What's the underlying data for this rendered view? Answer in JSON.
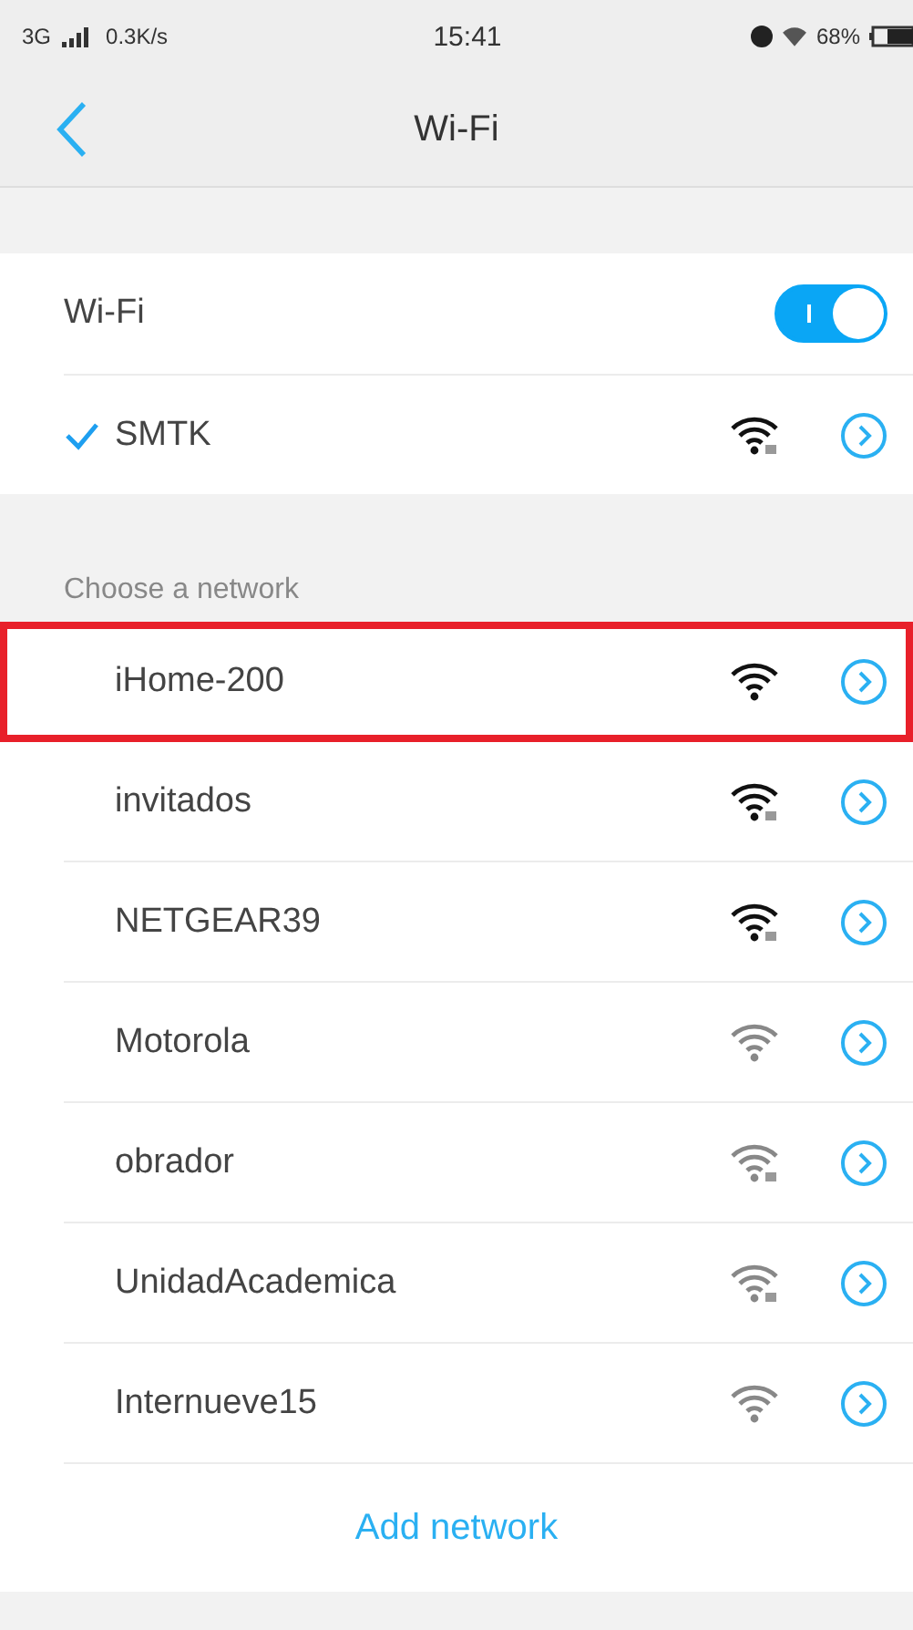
{
  "status_bar": {
    "network": "3G",
    "speed": "0.3K/s",
    "time": "15:41",
    "battery": "68%"
  },
  "nav": {
    "title": "Wi-Fi"
  },
  "wifi_switch": {
    "label": "Wi-Fi",
    "on": true
  },
  "connected": {
    "name": "SMTK",
    "checked": true,
    "locked": true,
    "strong": true
  },
  "section_label": "Choose a network",
  "networks": [
    {
      "name": "iHome-200",
      "locked": false,
      "strong": true,
      "highlighted": true
    },
    {
      "name": "invitados",
      "locked": true,
      "strong": true,
      "highlighted": false
    },
    {
      "name": "NETGEAR39",
      "locked": true,
      "strong": true,
      "highlighted": false
    },
    {
      "name": "Motorola",
      "locked": false,
      "strong": false,
      "highlighted": false
    },
    {
      "name": "obrador",
      "locked": true,
      "strong": false,
      "highlighted": false
    },
    {
      "name": "UnidadAcademica",
      "locked": true,
      "strong": false,
      "highlighted": false
    },
    {
      "name": "Internueve15",
      "locked": false,
      "strong": false,
      "highlighted": false
    }
  ],
  "add_network": "Add network"
}
